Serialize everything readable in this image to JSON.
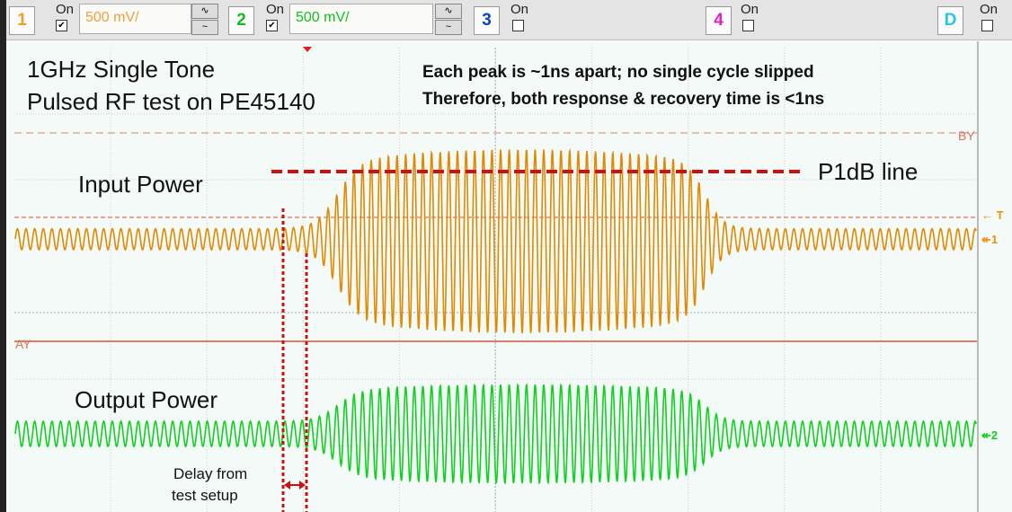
{
  "toolbar": {
    "channels": [
      {
        "id": "1",
        "on_label": "On",
        "checked": true,
        "scale": "500 mV/",
        "color": "#f0a020"
      },
      {
        "id": "2",
        "on_label": "On",
        "checked": true,
        "scale": "500 mV/",
        "color": "#10c020"
      },
      {
        "id": "3",
        "on_label": "On",
        "checked": false,
        "color": "#1040c0"
      },
      {
        "id": "4",
        "on_label": "On",
        "checked": false,
        "color": "#e020c0"
      },
      {
        "id": "D",
        "on_label": "On",
        "checked": false,
        "color": "#20c8e0"
      }
    ]
  },
  "annotations": {
    "title_line1": "1GHz Single Tone",
    "title_line2": "Pulsed RF test on PE45140",
    "note_line1": "Each peak is ~1ns apart; no single cycle slipped",
    "note_line2": "Therefore, both response & recovery time is <1ns",
    "p1db": "P1dB line",
    "input_power": "Input Power",
    "output_power": "Output Power",
    "delay_line1": "Delay from",
    "delay_line2": "test setup"
  },
  "markers": {
    "by": "BY",
    "ay": "AY",
    "trigger": "T",
    "ch1": "1",
    "ch2": "2"
  },
  "colors": {
    "ch1": "#e08a00",
    "ch2": "#10d020",
    "cursor": "#e05030",
    "annotation": "#cc1111"
  }
}
